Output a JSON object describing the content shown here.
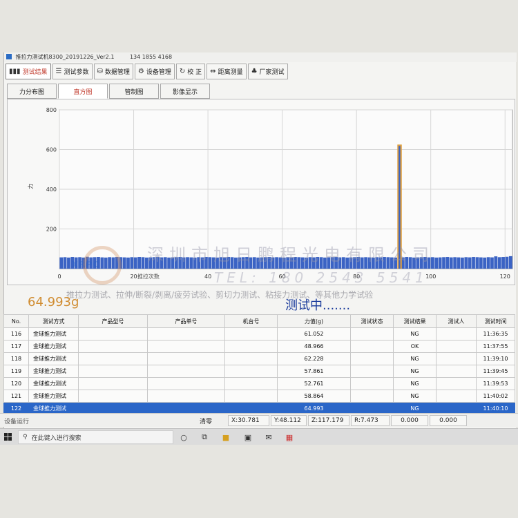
{
  "window": {
    "title": "推拉力测试机8300_20191226_Ver2.1",
    "phone": "134 1855 4168"
  },
  "toolbar": [
    {
      "label": "测试结果",
      "icon": "bar-chart-icon",
      "active": true
    },
    {
      "label": "测试参数",
      "icon": "sliders-icon"
    },
    {
      "label": "数据管理",
      "icon": "database-icon"
    },
    {
      "label": "设备管理",
      "icon": "gears-icon"
    },
    {
      "label": "校  正",
      "icon": "refresh-icon"
    },
    {
      "label": "距离测量",
      "icon": "distance-icon"
    },
    {
      "label": "厂家测试",
      "icon": "factory-icon"
    }
  ],
  "tabs": [
    {
      "label": "力分布图"
    },
    {
      "label": "直方图",
      "active": true
    },
    {
      "label": "管制图"
    },
    {
      "label": "影像显示"
    }
  ],
  "chart_data": {
    "type": "bar",
    "ylabel": "力",
    "xlabel": "推拉次数",
    "xlim": [
      0,
      122
    ],
    "ylim": [
      0,
      800
    ],
    "xticks": [
      0,
      20,
      40,
      60,
      80,
      100,
      120
    ],
    "yticks": [
      200,
      400,
      600,
      800
    ],
    "grid": true,
    "bar_color": "#3b63c4",
    "spike_color": "#e0a040",
    "values": [
      57,
      58,
      56,
      59,
      57,
      58,
      56,
      60,
      57,
      58,
      59,
      57,
      56,
      58,
      57,
      59,
      58,
      57,
      56,
      58,
      57,
      59,
      58,
      56,
      57,
      58,
      59,
      57,
      58,
      56,
      57,
      58,
      59,
      57,
      58,
      57,
      56,
      58,
      57,
      59,
      58,
      57,
      56,
      58,
      57,
      59,
      58,
      56,
      57,
      58,
      59,
      57,
      58,
      56,
      57,
      58,
      59,
      57,
      58,
      57,
      56,
      58,
      57,
      59,
      58,
      57,
      56,
      58,
      57,
      59,
      58,
      56,
      57,
      58,
      59,
      57,
      58,
      56,
      57,
      58,
      59,
      57,
      58,
      57,
      56,
      58,
      57,
      59,
      58,
      57,
      56,
      58,
      57,
      59,
      58,
      56,
      57,
      58,
      59,
      57,
      58,
      56,
      57,
      58,
      59,
      57,
      58,
      57,
      56,
      58,
      57,
      59,
      58,
      57,
      56,
      58,
      57,
      62,
      58,
      59,
      60,
      63
    ],
    "spike": {
      "index": 91,
      "value": 625
    }
  },
  "watermark": {
    "company": "深圳市旭日鹏程光电有限公司",
    "tel": "TEL: 180 2543 5541",
    "services": "推拉力测试、拉伸/断裂/剥离/疲劳试验、剪切力测试、粘接力测试、等其他力学试验",
    "logo": "XRPC"
  },
  "readout": {
    "force": "64.993g",
    "status": "测试中......."
  },
  "table": {
    "columns": [
      "No.",
      "测试方式",
      "产品型号",
      "产品单号",
      "机台号",
      "力值(g)",
      "测试状态",
      "测试结果",
      "测试人",
      "测试时间"
    ],
    "rows": [
      [
        "116",
        "金球推力测试",
        "",
        "",
        "",
        "61.052",
        "",
        "NG",
        "",
        "11:36:35"
      ],
      [
        "117",
        "金球推力测试",
        "",
        "",
        "",
        "48.966",
        "",
        "OK",
        "",
        "11:37:55"
      ],
      [
        "118",
        "金球推力测试",
        "",
        "",
        "",
        "62.228",
        "",
        "NG",
        "",
        "11:39:10"
      ],
      [
        "119",
        "金球推力测试",
        "",
        "",
        "",
        "57.861",
        "",
        "NG",
        "",
        "11:39:45"
      ],
      [
        "120",
        "金球推力测试",
        "",
        "",
        "",
        "52.761",
        "",
        "NG",
        "",
        "11:39:53"
      ],
      [
        "121",
        "金球推力测试",
        "",
        "",
        "",
        "58.864",
        "",
        "NG",
        "",
        "11:40:02"
      ],
      [
        "122",
        "金球推力测试",
        "",
        "",
        "",
        "64.993",
        "",
        "NG",
        "",
        "11:40:10"
      ]
    ],
    "selected_row": 6
  },
  "statusbar": {
    "label": "设备运行",
    "clear": "清零",
    "x": "X:30.781",
    "y": "Y:48.112",
    "z": "Z:117.179",
    "r": "R:7.473",
    "v1": "0.000",
    "v2": "0.000"
  },
  "taskbar": {
    "search_placeholder": "在此键入进行搜索"
  }
}
